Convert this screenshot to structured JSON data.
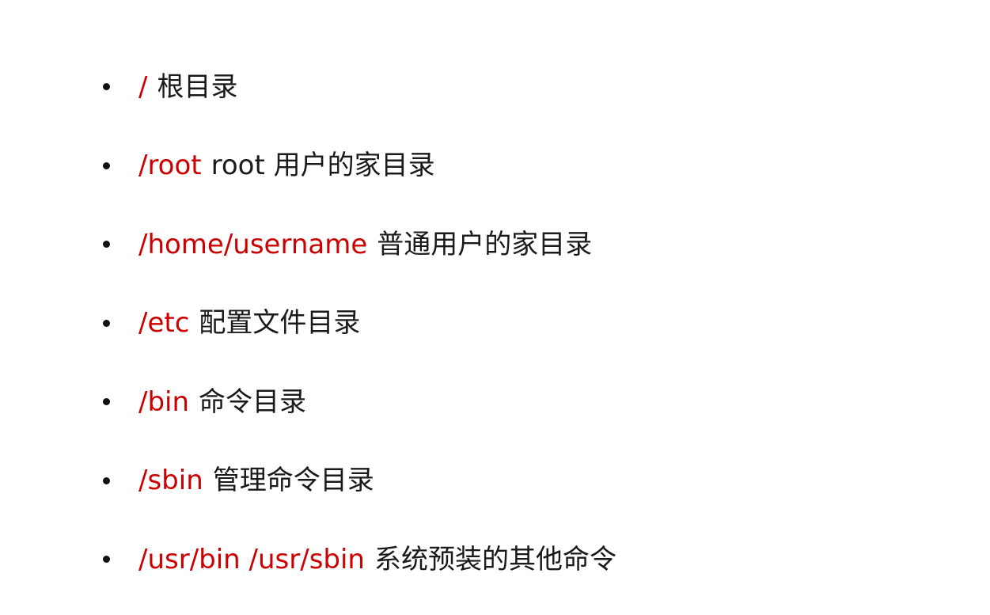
{
  "colors": {
    "path": "#cc0000",
    "text": "#1a1a1a",
    "bullet": "#111111",
    "background": "#ffffff"
  },
  "items": [
    {
      "path": "/",
      "description": "根目录"
    },
    {
      "path": "/root",
      "description": "root 用户的家目录"
    },
    {
      "path": "/home/username",
      "description": "普通用户的家目录"
    },
    {
      "path": "/etc",
      "description": "配置文件目录"
    },
    {
      "path": "/bin",
      "description": "命令目录"
    },
    {
      "path": "/sbin",
      "description": "管理命令目录"
    },
    {
      "path": "/usr/bin /usr/sbin",
      "description": "系统预装的其他命令"
    }
  ]
}
